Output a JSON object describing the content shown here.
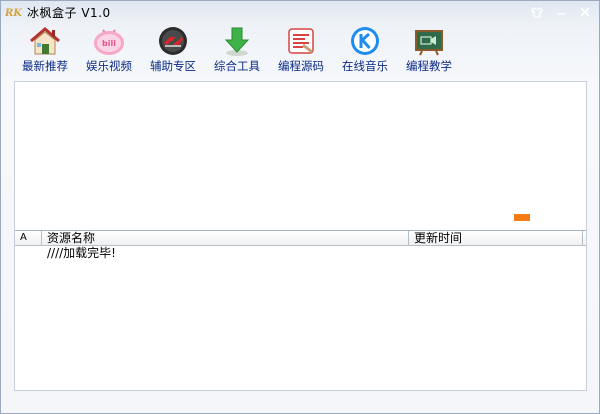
{
  "window": {
    "title": "冰枫盒子 V1.0",
    "logo_text": "RK"
  },
  "toolbar": {
    "items": [
      {
        "label": "最新推荐",
        "icon": "house-icon"
      },
      {
        "label": "娱乐视频",
        "icon": "bilibili-icon"
      },
      {
        "label": "辅助专区",
        "icon": "crossfire-icon"
      },
      {
        "label": "综合工具",
        "icon": "download-arrow-icon"
      },
      {
        "label": "编程源码",
        "icon": "source-code-icon"
      },
      {
        "label": "在线音乐",
        "icon": "kugou-music-icon"
      },
      {
        "label": "编程教学",
        "icon": "chalkboard-icon"
      }
    ]
  },
  "progress": {
    "value": 0.05
  },
  "resource_list": {
    "columns": [
      "A",
      "资源名称",
      "更新时间"
    ],
    "rows": [
      {
        "index": "",
        "name": "////加载完毕!",
        "time": ""
      }
    ]
  },
  "colors": {
    "label": "#0a2a86",
    "progress": "#f57c13"
  }
}
